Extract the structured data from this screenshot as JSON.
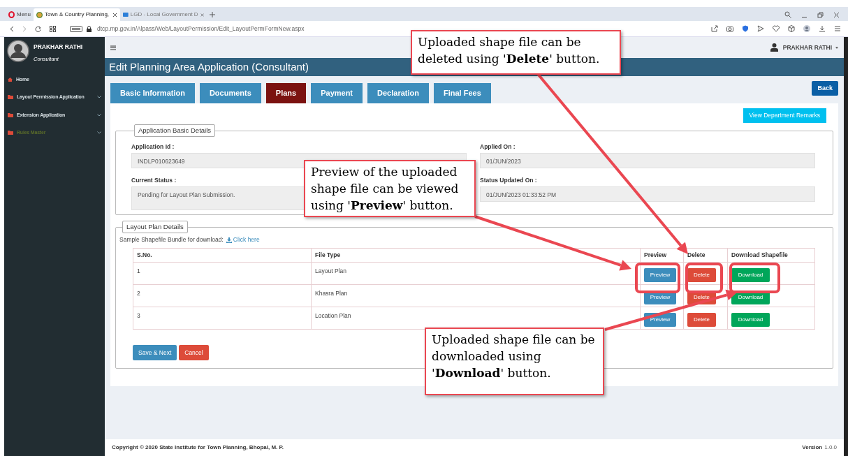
{
  "browser": {
    "menu_label": "Menu",
    "tabs": [
      {
        "label": "Town & Country Planning,",
        "selected": true
      },
      {
        "label": "LGD - Local Government D",
        "selected": false
      }
    ],
    "url": "dtcp.mp.gov.in/Alpass/Web/LayoutPermission/Edit_LayoutPermFormNew.aspx"
  },
  "sidebar": {
    "user_name": "PRAKHAR RATHI",
    "user_role": "Consultant",
    "items": [
      {
        "label": "Home",
        "has_submenu": false,
        "disabled": false
      },
      {
        "label": "Layout Permission Application",
        "has_submenu": true,
        "disabled": false
      },
      {
        "label": "Extension Application",
        "has_submenu": true,
        "disabled": false
      },
      {
        "label": "Rules Master",
        "has_submenu": true,
        "disabled": true
      }
    ]
  },
  "header": {
    "user_name": "PRAKHAR RATHI"
  },
  "page_title": "Edit Planning Area Application (Consultant)",
  "tabs": [
    {
      "label": "Basic Information",
      "selected": false
    },
    {
      "label": "Documents",
      "selected": false
    },
    {
      "label": "Plans",
      "selected": true
    },
    {
      "label": "Payment",
      "selected": false
    },
    {
      "label": "Declaration",
      "selected": false
    },
    {
      "label": "Final Fees",
      "selected": false
    }
  ],
  "back_button": "Back",
  "remarks_button": "View Department Remarks",
  "basic_details": {
    "legend": "Application Basic Details",
    "fields": [
      {
        "label": "Application Id :",
        "value": "INDLP010623649"
      },
      {
        "label": "Applied On :",
        "value": "01/JUN/2023"
      },
      {
        "label": "Current Status :",
        "value": "Pending for Layout Plan Submission."
      },
      {
        "label": "Status Updated On :",
        "value": "01/JUN/2023 01:33:52 PM"
      }
    ]
  },
  "layout_plan": {
    "legend": "Layout Plan Details",
    "sample_text": "Sample Shapefile Bundle for download:",
    "sample_link": "Click here",
    "columns": [
      "S.No.",
      "File Type",
      "Preview",
      "Delete",
      "Download Shapefile"
    ],
    "rows": [
      {
        "sno": "1",
        "file_type": "Layout Plan",
        "preview": "Preview",
        "delete": "Delete",
        "download": "Download"
      },
      {
        "sno": "2",
        "file_type": "Khasra Plan",
        "preview": "Preview",
        "delete": "Delete",
        "download": "Download"
      },
      {
        "sno": "3",
        "file_type": "Location Plan",
        "preview": "Preview",
        "delete": "Delete",
        "download": "Download"
      }
    ],
    "save_button": "Save & Next",
    "cancel_button": "Cancel"
  },
  "footer": {
    "copyright": "Copyright © 2020 State Institute for Town Planning, Bhopal, M. P.",
    "version_label": "Version",
    "version": "1.0.0"
  },
  "callouts": [
    {
      "text": "Uploaded shape file can be deleted using '**Delete**' button."
    },
    {
      "text": "Preview of the uploaded shape file can be viewed using '**Preview**' button."
    },
    {
      "text": "Uploaded shape file can be downloaded using '**Download**' button."
    }
  ]
}
